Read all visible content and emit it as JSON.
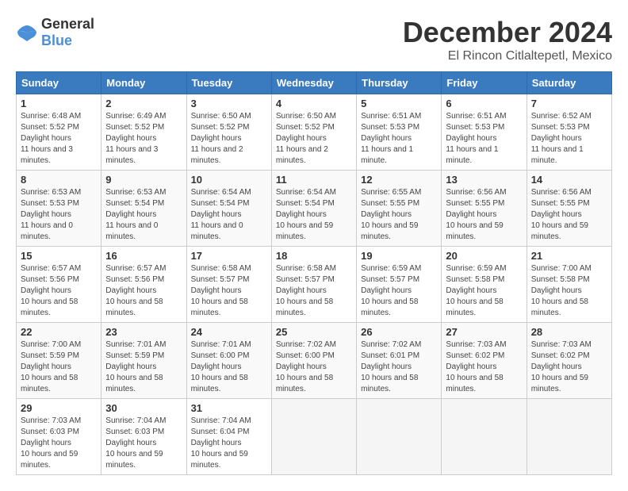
{
  "logo": {
    "general": "General",
    "blue": "Blue"
  },
  "title": "December 2024",
  "location": "El Rincon Citlaltepetl, Mexico",
  "days_of_week": [
    "Sunday",
    "Monday",
    "Tuesday",
    "Wednesday",
    "Thursday",
    "Friday",
    "Saturday"
  ],
  "weeks": [
    [
      {
        "day": "1",
        "sunrise": "6:48 AM",
        "sunset": "5:52 PM",
        "daylight": "11 hours and 3 minutes."
      },
      {
        "day": "2",
        "sunrise": "6:49 AM",
        "sunset": "5:52 PM",
        "daylight": "11 hours and 3 minutes."
      },
      {
        "day": "3",
        "sunrise": "6:50 AM",
        "sunset": "5:52 PM",
        "daylight": "11 hours and 2 minutes."
      },
      {
        "day": "4",
        "sunrise": "6:50 AM",
        "sunset": "5:52 PM",
        "daylight": "11 hours and 2 minutes."
      },
      {
        "day": "5",
        "sunrise": "6:51 AM",
        "sunset": "5:53 PM",
        "daylight": "11 hours and 1 minute."
      },
      {
        "day": "6",
        "sunrise": "6:51 AM",
        "sunset": "5:53 PM",
        "daylight": "11 hours and 1 minute."
      },
      {
        "day": "7",
        "sunrise": "6:52 AM",
        "sunset": "5:53 PM",
        "daylight": "11 hours and 1 minute."
      }
    ],
    [
      {
        "day": "8",
        "sunrise": "6:53 AM",
        "sunset": "5:53 PM",
        "daylight": "11 hours and 0 minutes."
      },
      {
        "day": "9",
        "sunrise": "6:53 AM",
        "sunset": "5:54 PM",
        "daylight": "11 hours and 0 minutes."
      },
      {
        "day": "10",
        "sunrise": "6:54 AM",
        "sunset": "5:54 PM",
        "daylight": "11 hours and 0 minutes."
      },
      {
        "day": "11",
        "sunrise": "6:54 AM",
        "sunset": "5:54 PM",
        "daylight": "10 hours and 59 minutes."
      },
      {
        "day": "12",
        "sunrise": "6:55 AM",
        "sunset": "5:55 PM",
        "daylight": "10 hours and 59 minutes."
      },
      {
        "day": "13",
        "sunrise": "6:56 AM",
        "sunset": "5:55 PM",
        "daylight": "10 hours and 59 minutes."
      },
      {
        "day": "14",
        "sunrise": "6:56 AM",
        "sunset": "5:55 PM",
        "daylight": "10 hours and 59 minutes."
      }
    ],
    [
      {
        "day": "15",
        "sunrise": "6:57 AM",
        "sunset": "5:56 PM",
        "daylight": "10 hours and 58 minutes."
      },
      {
        "day": "16",
        "sunrise": "6:57 AM",
        "sunset": "5:56 PM",
        "daylight": "10 hours and 58 minutes."
      },
      {
        "day": "17",
        "sunrise": "6:58 AM",
        "sunset": "5:57 PM",
        "daylight": "10 hours and 58 minutes."
      },
      {
        "day": "18",
        "sunrise": "6:58 AM",
        "sunset": "5:57 PM",
        "daylight": "10 hours and 58 minutes."
      },
      {
        "day": "19",
        "sunrise": "6:59 AM",
        "sunset": "5:57 PM",
        "daylight": "10 hours and 58 minutes."
      },
      {
        "day": "20",
        "sunrise": "6:59 AM",
        "sunset": "5:58 PM",
        "daylight": "10 hours and 58 minutes."
      },
      {
        "day": "21",
        "sunrise": "7:00 AM",
        "sunset": "5:58 PM",
        "daylight": "10 hours and 58 minutes."
      }
    ],
    [
      {
        "day": "22",
        "sunrise": "7:00 AM",
        "sunset": "5:59 PM",
        "daylight": "10 hours and 58 minutes."
      },
      {
        "day": "23",
        "sunrise": "7:01 AM",
        "sunset": "5:59 PM",
        "daylight": "10 hours and 58 minutes."
      },
      {
        "day": "24",
        "sunrise": "7:01 AM",
        "sunset": "6:00 PM",
        "daylight": "10 hours and 58 minutes."
      },
      {
        "day": "25",
        "sunrise": "7:02 AM",
        "sunset": "6:00 PM",
        "daylight": "10 hours and 58 minutes."
      },
      {
        "day": "26",
        "sunrise": "7:02 AM",
        "sunset": "6:01 PM",
        "daylight": "10 hours and 58 minutes."
      },
      {
        "day": "27",
        "sunrise": "7:03 AM",
        "sunset": "6:02 PM",
        "daylight": "10 hours and 58 minutes."
      },
      {
        "day": "28",
        "sunrise": "7:03 AM",
        "sunset": "6:02 PM",
        "daylight": "10 hours and 59 minutes."
      }
    ],
    [
      {
        "day": "29",
        "sunrise": "7:03 AM",
        "sunset": "6:03 PM",
        "daylight": "10 hours and 59 minutes."
      },
      {
        "day": "30",
        "sunrise": "7:04 AM",
        "sunset": "6:03 PM",
        "daylight": "10 hours and 59 minutes."
      },
      {
        "day": "31",
        "sunrise": "7:04 AM",
        "sunset": "6:04 PM",
        "daylight": "10 hours and 59 minutes."
      },
      null,
      null,
      null,
      null
    ]
  ]
}
